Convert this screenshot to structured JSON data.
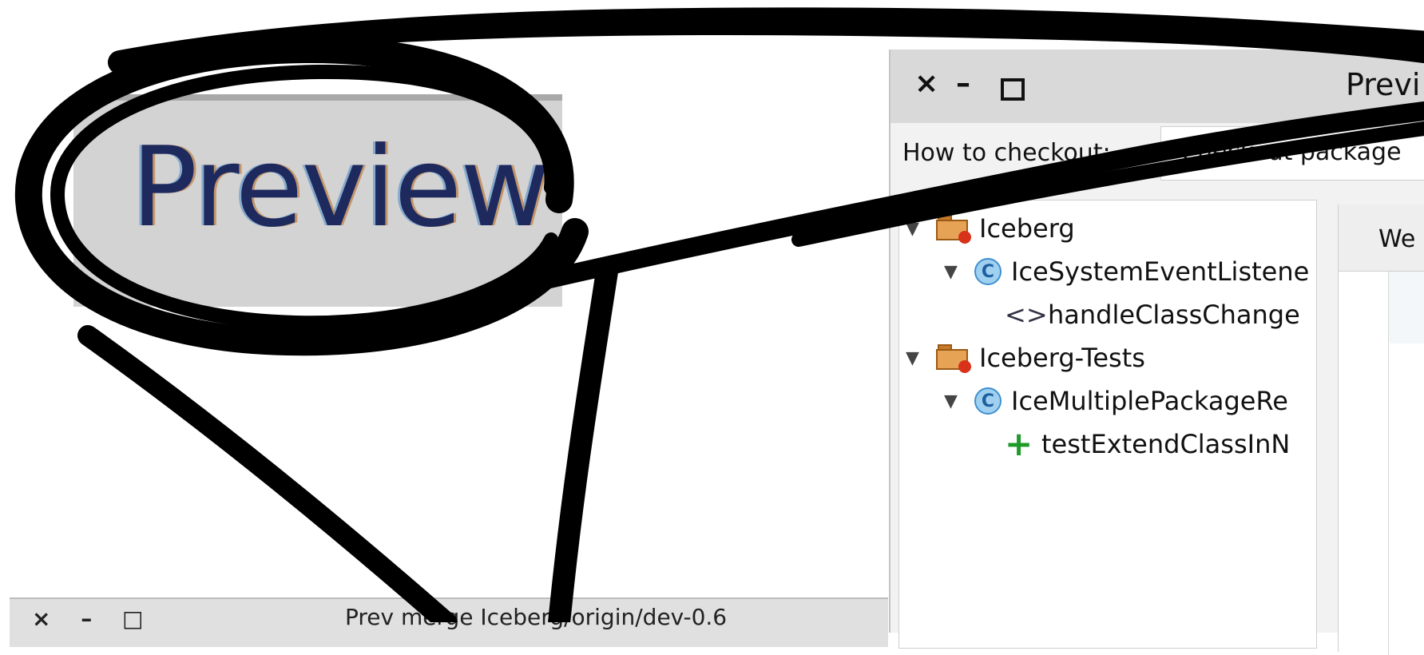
{
  "zoom": {
    "text": "Preview ı"
  },
  "mini_window": {
    "controls": "× – □",
    "title": "Prev   merge   Iceberg/origin/dev-0.6"
  },
  "dialog": {
    "close_icon": "×",
    "minimize_icon": "–",
    "maximize_icon": "□",
    "title": "Previ",
    "checkout_label": "How to checkout:",
    "checkout_value": "Checkout package",
    "tree": [
      {
        "label": "Iceberg",
        "kind": "package",
        "icon": "package-icon",
        "expanded": true
      },
      {
        "label": "IceSystemEventListene",
        "kind": "class",
        "icon": "class-icon",
        "expanded": true
      },
      {
        "label": "handleClassChange",
        "kind": "method",
        "icon": "method-modified-icon"
      },
      {
        "label": "Iceberg-Tests",
        "kind": "package",
        "icon": "package-icon",
        "expanded": true
      },
      {
        "label": "IceMultiplePackageRe",
        "kind": "class",
        "icon": "class-icon",
        "expanded": true
      },
      {
        "label": "testExtendClassInN",
        "kind": "method",
        "icon": "method-added-icon"
      }
    ],
    "diff_tab_label": "We",
    "class_glyph": "C",
    "method_glyph": "<>",
    "add_glyph": "+",
    "expand_glyph": "▼"
  },
  "colors": {
    "titlebar": "#d9d9d9",
    "class_icon": "#9fd0f0",
    "package_icon": "#e6a356",
    "added": "#1e9a2a",
    "scribble": "#000000"
  }
}
